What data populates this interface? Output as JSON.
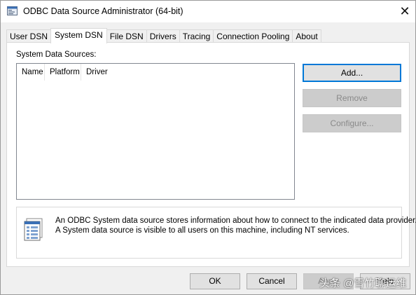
{
  "window": {
    "title": "ODBC Data Source Administrator (64-bit)",
    "close_glyph": "✕"
  },
  "tabs": [
    {
      "label": "User DSN",
      "active": false
    },
    {
      "label": "System DSN",
      "active": true
    },
    {
      "label": "File DSN",
      "active": false
    },
    {
      "label": "Drivers",
      "active": false
    },
    {
      "label": "Tracing",
      "active": false
    },
    {
      "label": "Connection Pooling",
      "active": false
    },
    {
      "label": "About",
      "active": false
    }
  ],
  "system_dsn": {
    "section_label": "System Data Sources:",
    "columns": [
      "Name",
      "Platform",
      "Driver"
    ],
    "rows": [],
    "buttons": {
      "add": "Add...",
      "remove": "Remove",
      "configure": "Configure..."
    },
    "info": {
      "icon": "database-sources-icon",
      "line1": "An ODBC System data source stores information about how to connect to the indicated data provider.",
      "line2": "A System data source is visible to all users on this machine, including NT services."
    }
  },
  "footer": {
    "ok": "OK",
    "cancel": "Cancel",
    "apply": "Apply",
    "help": "Help"
  },
  "watermark": "头条 @雪竹聊运维",
  "colors": {
    "accent": "#0078d7",
    "background": "#f0f0f0",
    "disabled_text": "#8a8a8a"
  }
}
